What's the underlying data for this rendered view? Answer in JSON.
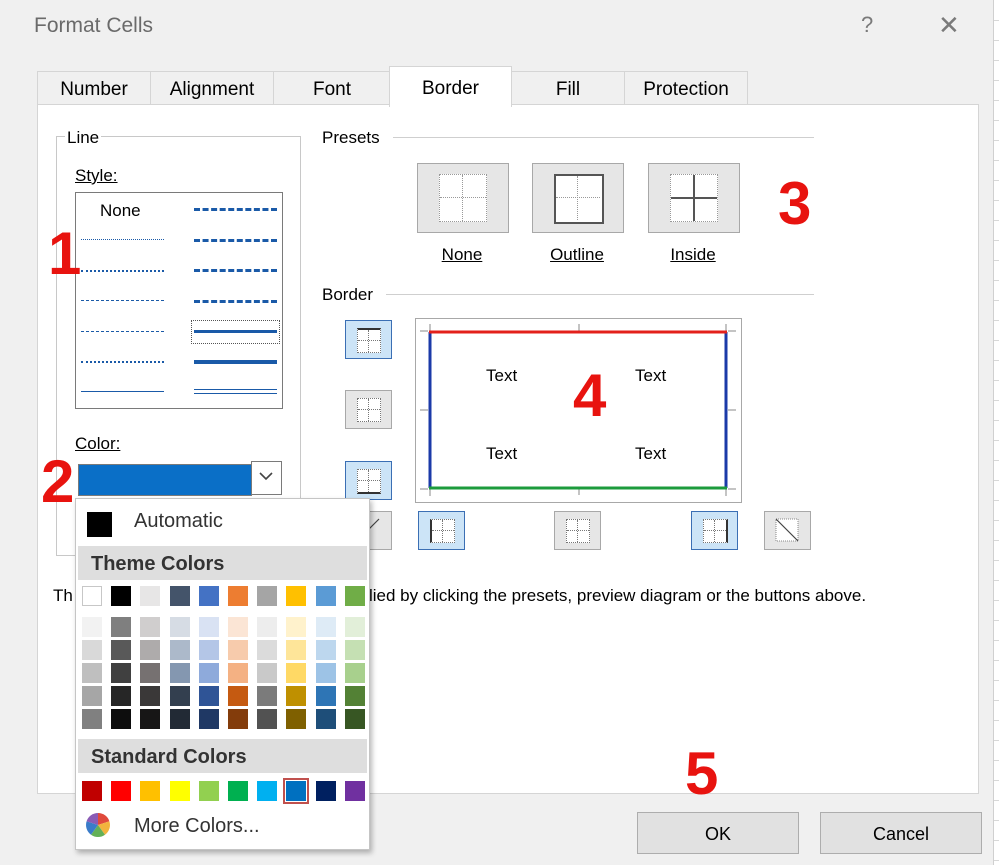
{
  "window": {
    "title": "Format Cells",
    "help": "?",
    "close": "✕"
  },
  "tabs": [
    "Number",
    "Alignment",
    "Font",
    "Border",
    "Fill",
    "Protection"
  ],
  "active_tab": "Border",
  "line": {
    "group_label": "Line",
    "style_label": "Style:",
    "none_label": "None",
    "color_label": "Color:",
    "selected_color": "#0a6fc7"
  },
  "presets": {
    "group_label": "Presets",
    "items": [
      "None",
      "Outline",
      "Inside"
    ]
  },
  "border": {
    "group_label": "Border",
    "preview_text": [
      "Text",
      "Text",
      "Text",
      "Text"
    ],
    "top_color": "#e3201b",
    "left_right_color": "#1b3aa8",
    "bottom_color": "#1c9b3c"
  },
  "info_text_left": "Th",
  "info_text_right": "lied by clicking the presets, preview diagram or the buttons above.",
  "annotations": [
    "1",
    "2",
    "3",
    "4",
    "5"
  ],
  "buttons": {
    "ok": "OK",
    "cancel": "Cancel"
  },
  "color_dropdown": {
    "automatic_label": "Automatic",
    "theme_label": "Theme Colors",
    "standard_label": "Standard Colors",
    "more_colors_label": "More Colors...",
    "theme_top": [
      "#ffffff",
      "#000000",
      "#e7e6e6",
      "#44546a",
      "#4472c4",
      "#ed7d31",
      "#a5a5a5",
      "#ffc000",
      "#5b9bd5",
      "#70ad47"
    ],
    "theme_shades": [
      [
        "#f2f2f2",
        "#d9d9d9",
        "#bfbfbf",
        "#a6a6a6",
        "#808080"
      ],
      [
        "#7f7f7f",
        "#595959",
        "#404040",
        "#262626",
        "#0d0d0d"
      ],
      [
        "#d0cece",
        "#aeabab",
        "#767171",
        "#3a3838",
        "#171616"
      ],
      [
        "#d6dce4",
        "#acb9ca",
        "#8497b0",
        "#333f4f",
        "#222a35"
      ],
      [
        "#d9e2f3",
        "#b4c6e7",
        "#8eaadb",
        "#2f5496",
        "#1f3864"
      ],
      [
        "#fbe5d5",
        "#f7cbac",
        "#f4b183",
        "#c55a11",
        "#833c0b"
      ],
      [
        "#ededed",
        "#dbdbdb",
        "#c9c9c9",
        "#7b7b7b",
        "#525252"
      ],
      [
        "#fff2cc",
        "#fee599",
        "#ffd965",
        "#bf9000",
        "#7f6000"
      ],
      [
        "#deebf6",
        "#bdd7ee",
        "#9dc3e6",
        "#2e75b5",
        "#1e4e79"
      ],
      [
        "#e2efd9",
        "#c5e0b3",
        "#a8d08d",
        "#538135",
        "#375623"
      ]
    ],
    "standard": [
      "#c00000",
      "#ff0000",
      "#ffc000",
      "#ffff00",
      "#92d050",
      "#00b050",
      "#00b0f0",
      "#0070c0",
      "#002060",
      "#7030a0"
    ],
    "selected_standard_index": 7
  }
}
